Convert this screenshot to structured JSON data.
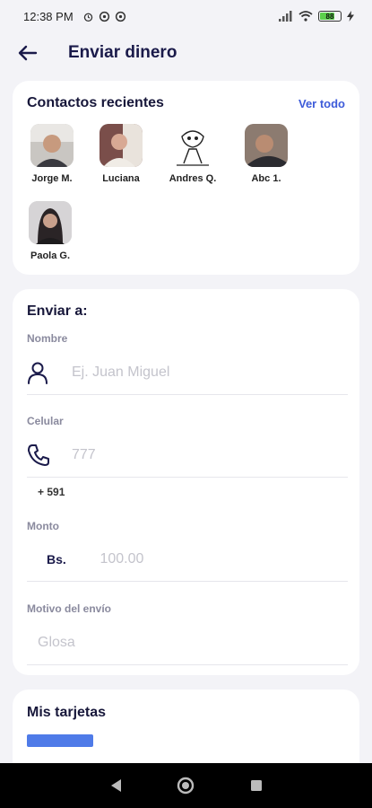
{
  "status_bar": {
    "time": "12:38 PM",
    "battery": "88"
  },
  "header": {
    "title": "Enviar dinero"
  },
  "recent": {
    "title": "Contactos recientes",
    "see_all": "Ver todo",
    "contacts": [
      {
        "name": "Jorge M."
      },
      {
        "name": "Luciana"
      },
      {
        "name": "Andres Q."
      },
      {
        "name": "Abc 1."
      },
      {
        "name": "Paola G."
      }
    ]
  },
  "send": {
    "title": "Enviar a:",
    "name_label": "Nombre",
    "name_placeholder": "Ej. Juan Miguel",
    "phone_label": "Celular",
    "phone_placeholder": "777",
    "phone_prefix": "+ 591",
    "amount_label": "Monto",
    "currency": "Bs.",
    "amount_placeholder": "100.00",
    "memo_label": "Motivo del envío",
    "memo_placeholder": "Glosa"
  },
  "cards": {
    "title": "Mis tarjetas"
  },
  "colors": {
    "accent": "#3d5bd9",
    "title": "#1a1a4a",
    "card_bar": "#4f7be8"
  }
}
